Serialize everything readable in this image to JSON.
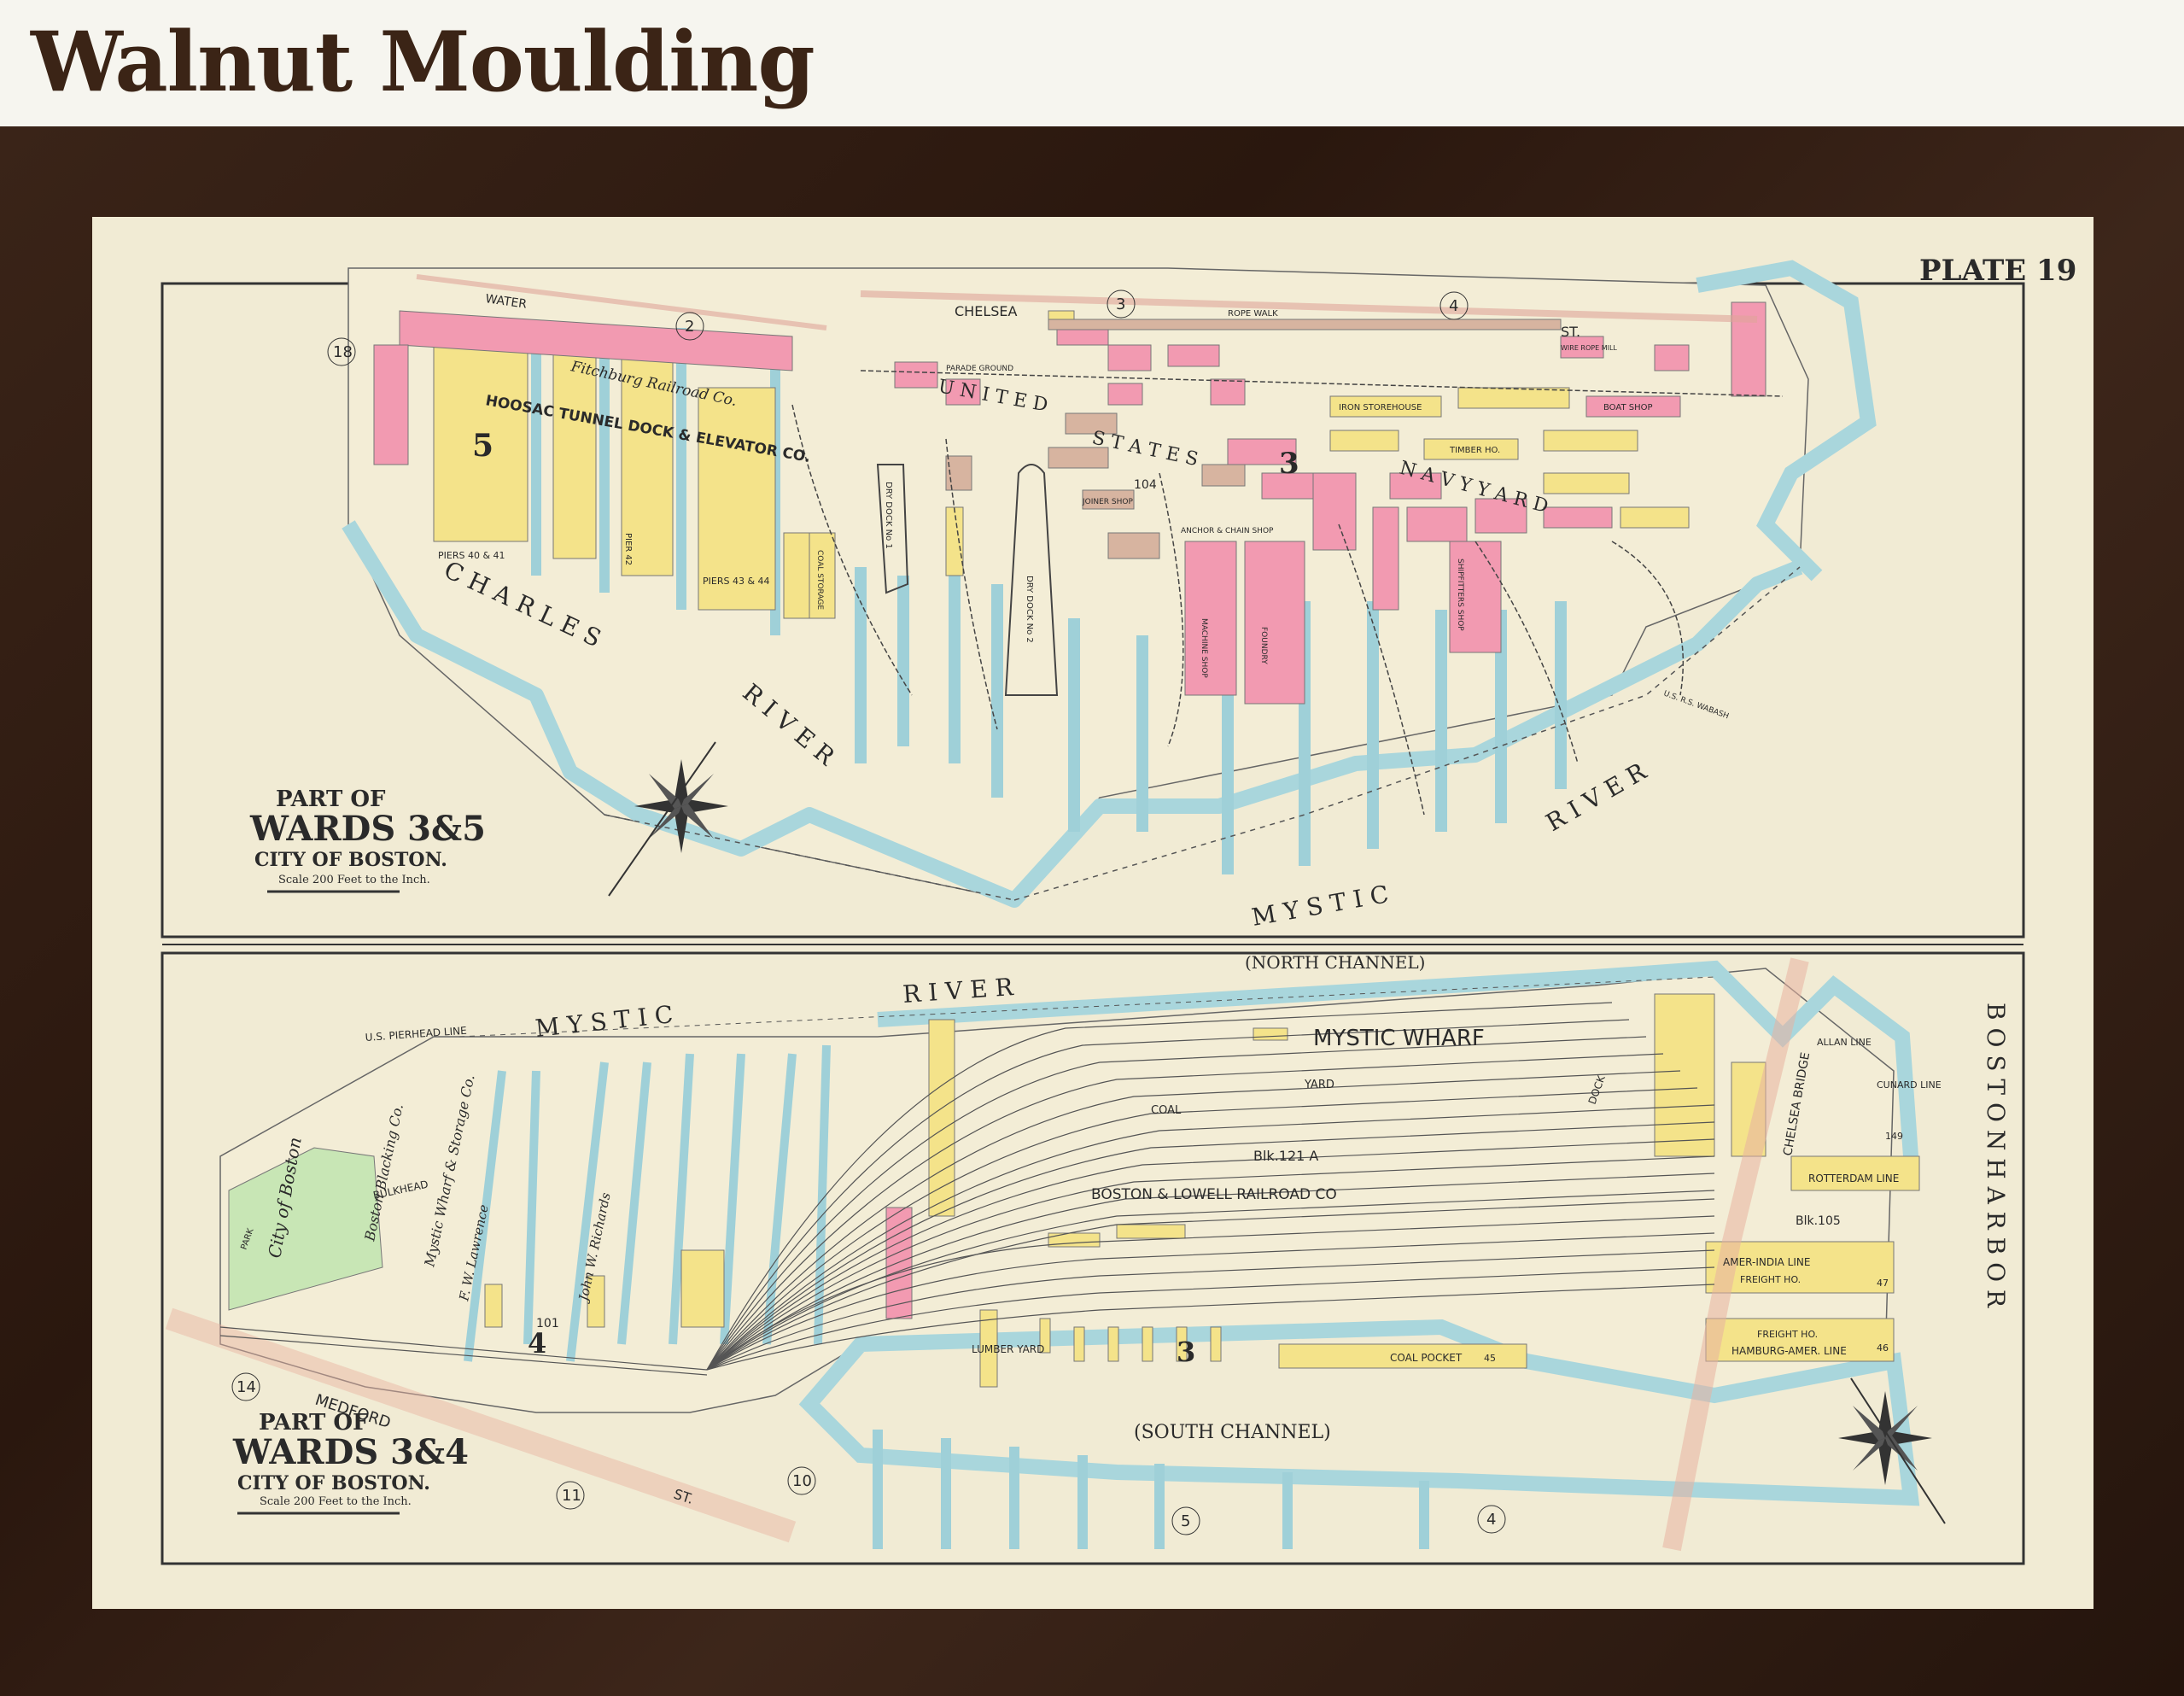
{
  "header": {
    "title": "Walnut Moulding"
  },
  "map": {
    "plate": "PLATE 19",
    "top": {
      "title_line1": "PART OF",
      "title_line2": "WARDS 3&5",
      "title_line3": "CITY OF BOSTON.",
      "scale": "Scale 200 Feet to the Inch.",
      "river_charles": "C H A R L E S",
      "river_word": "R I V E R",
      "mystic": "M Y S T I C",
      "mystic_river": "R I V E R",
      "street_chelsea": "CHELSEA",
      "street_st": "ST.",
      "street_water": "WATER",
      "united": "U N I T E D",
      "states": "S T A T E S",
      "navy_yard": "N A V Y   Y A R D",
      "hoosac": "HOOSAC TUNNEL DOCK & ELEVATOR CO.",
      "fitchburg": "Fitchburg Railroad Co.",
      "ward_5": "5",
      "ward_3": "3",
      "num_2": "2",
      "num_3": "3",
      "num_4": "4",
      "num_18": "18",
      "num_104": "104",
      "piers_40": "PIERS 40 & 41",
      "piers_43": "PIERS 43 & 44",
      "pier_42": "PIER 42",
      "coal_storage": "COAL STORAGE",
      "dry_dock_1": "DRY DOCK No 1",
      "dry_dock_2": "DRY DOCK No 2",
      "rope_walk": "ROPE WALK",
      "parade_ground": "PARADE GROUND",
      "iron_storehouse": "IRON STOREHOUSE",
      "boat_shop": "BOAT SHOP",
      "timber_ho": "TIMBER HO.",
      "joiner_shop": "JOINER SHOP",
      "machine_shop": "MACHINE SHOP",
      "foundry": "FOUNDRY",
      "ship_fitters": "SHIPFITTERS SHOP",
      "anchor_chain": "ANCHOR & CHAIN SHOP",
      "wire_rope_mill": "WIRE ROPE MILL",
      "us_marine": "U.S. R.S. WABASH"
    },
    "bottom": {
      "title_line1": "PART OF",
      "title_line2": "WARDS 3&4",
      "title_line3": "CITY OF BOSTON.",
      "scale": "Scale 200 Feet to the Inch.",
      "mystic": "M Y S T I C",
      "river": "R I V E R",
      "north_channel": "(NORTH  CHANNEL)",
      "south_channel": "(SOUTH  CHANNEL)",
      "mystic_wharf": "MYSTIC WHARF",
      "yard": "YARD",
      "coal": "COAL",
      "blk121a": "Blk.121 A",
      "railroad": "BOSTON  &  LOWELL  RAILROAD  CO",
      "boston_harbor": "B O S T O N   H A R B O R",
      "chelsea_bridge": "CHELSEA   BRIDGE",
      "dock": "DOCK",
      "allan_line": "ALLAN LINE",
      "cunard": "CUNARD LINE",
      "rotterdam": "ROTTERDAM LINE",
      "blk105": "Blk.105",
      "amer_india": "AMER-INDIA  LINE",
      "freight_ho": "FREIGHT HO.",
      "freight_ho2": "FREIGHT HO.",
      "hamburg": "HAMBURG-AMER. LINE",
      "coal_pocket": "COAL  POCKET",
      "lumber_yard": "LUMBER  YARD",
      "ward_3": "3",
      "ward_4": "4",
      "num_14": "14",
      "num_11": "11",
      "num_10": "10",
      "num_5": "5",
      "num_4": "4",
      "num_101": "101",
      "num_45": "45",
      "num_46": "46",
      "num_47": "47",
      "num_149": "149",
      "medford": "MEDFORD",
      "st": "ST.",
      "pierhead": "U.S.   PIERHEAD   LINE",
      "bulkhead": "BULKHEAD",
      "city_boston": "City of Boston",
      "blacking": "Boston Blacking Co.",
      "mystic_wharf_co": "Mystic Wharf & Storage Co.",
      "lawrence": "F. W. Lawrence",
      "john_richards": "John W. Richards",
      "park": "PARK"
    }
  }
}
